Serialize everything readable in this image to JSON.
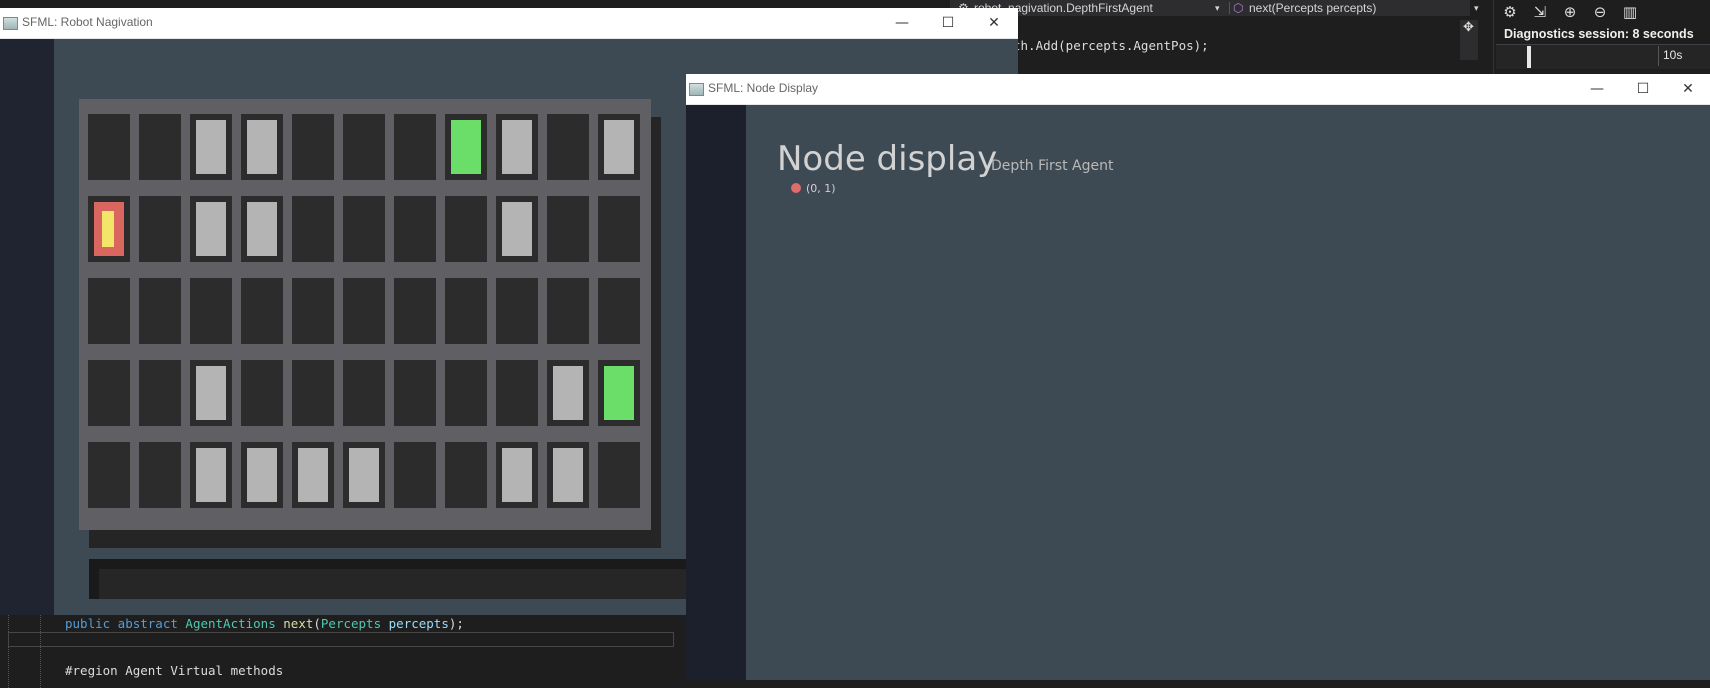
{
  "ide": {
    "nav_class": "robot_nagivation.DepthFirstAgent",
    "nav_method": "next(Percepts percepts)",
    "code_line_top": "th.Add(percepts.AgentPos);",
    "diagnostics_title": "Diagnostics session: 8 seconds",
    "diagnostics_scale": "10s",
    "bottom_code": {
      "line1_kw": "public abstract",
      "line1_type": "AgentActions",
      "line1_fn": "next",
      "line1_param_type": "Percepts",
      "line1_param": "percepts",
      "line1_end": ");",
      "line3": "#region Agent Virtual methods"
    }
  },
  "robot_window": {
    "title": "SFML: Robot Nagivation",
    "minimize_label": "—",
    "maximize_label": "☐",
    "close_label": "✕",
    "grid": {
      "rows": 5,
      "cols": 11,
      "cells": [
        [
          "empty",
          "empty",
          "wall",
          "wall",
          "empty",
          "empty",
          "empty",
          "goal",
          "wall",
          "empty",
          "wall"
        ],
        [
          "agent",
          "empty",
          "wall",
          "wall",
          "empty",
          "empty",
          "empty",
          "empty",
          "wall",
          "empty",
          "empty"
        ],
        [
          "empty",
          "empty",
          "empty",
          "empty",
          "empty",
          "empty",
          "empty",
          "empty",
          "empty",
          "empty",
          "empty"
        ],
        [
          "empty",
          "empty",
          "wall",
          "empty",
          "empty",
          "empty",
          "empty",
          "empty",
          "empty",
          "wall",
          "goal"
        ],
        [
          "empty",
          "empty",
          "wall",
          "wall",
          "wall",
          "wall",
          "empty",
          "empty",
          "wall",
          "wall",
          "empty"
        ]
      ]
    },
    "colors": {
      "empty": "#2c2c2c",
      "wall": "#b4b4b4",
      "goal": "#6ade69",
      "agent_bg": "#d9665f",
      "agent_robot": "#f3e46a"
    }
  },
  "node_window": {
    "title": "SFML: Node Display",
    "minimize_label": "—",
    "maximize_label": "☐",
    "close_label": "✕",
    "heading": "Node display",
    "subheading": "Depth First Agent",
    "nodes": [
      {
        "label": "(0, 1)",
        "color": "#e06c6c"
      }
    ]
  }
}
